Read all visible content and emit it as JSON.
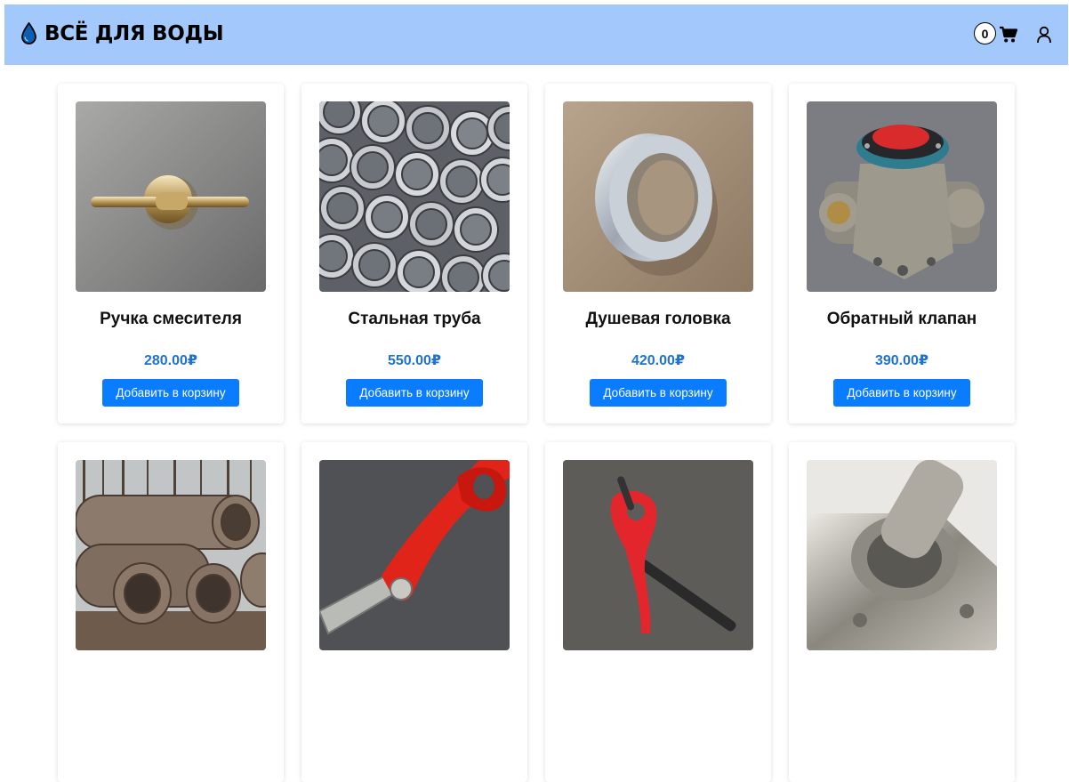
{
  "header": {
    "logo_icon": "water-drop-icon",
    "logo_text": "ВСЁ ДЛЯ ВОДЫ",
    "cart_count": "0",
    "cart_icon": "shopping-cart-icon",
    "user_icon": "user-icon",
    "background": "#a3c8fb"
  },
  "products": [
    {
      "name": "Ручка смесителя",
      "price": "280.00₽",
      "button": "Добавить в корзину"
    },
    {
      "name": "Стальная труба",
      "price": "550.00₽",
      "button": "Добавить в корзину"
    },
    {
      "name": "Душевая головка",
      "price": "420.00₽",
      "button": "Добавить в корзину"
    },
    {
      "name": "Обратный клапан",
      "price": "390.00₽",
      "button": "Добавить в корзину"
    },
    {
      "name": "",
      "price": "",
      "button": ""
    },
    {
      "name": "",
      "price": "",
      "button": ""
    },
    {
      "name": "",
      "price": "",
      "button": ""
    },
    {
      "name": "",
      "price": "",
      "button": ""
    }
  ],
  "colors": {
    "accent": "#0a7cff",
    "price": "#1f72cf"
  }
}
